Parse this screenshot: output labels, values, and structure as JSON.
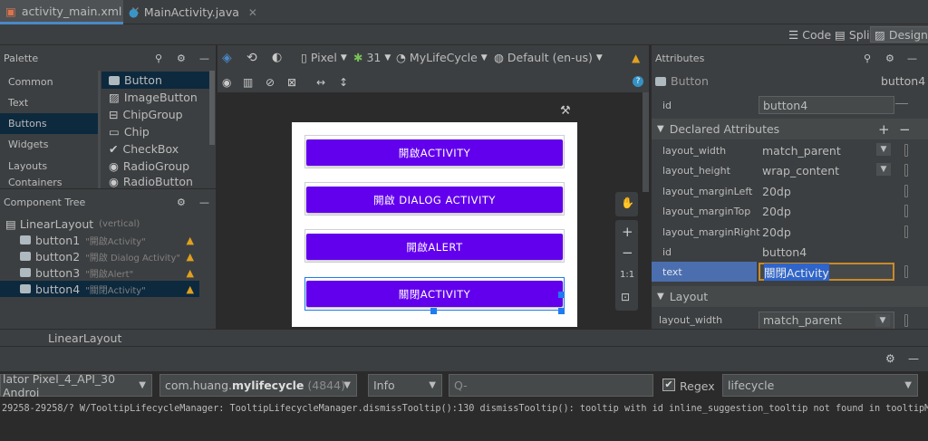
{
  "tabs": [
    {
      "label": "activity_main.xml",
      "active": true
    },
    {
      "label": "MainActivity.java",
      "active": false
    }
  ],
  "modes": {
    "code": "Code",
    "split": "Split",
    "design": "Design"
  },
  "palette": {
    "title": "Palette",
    "categories": [
      "Common",
      "Text",
      "Buttons",
      "Widgets",
      "Layouts",
      "Containers"
    ],
    "selected_category": "Buttons",
    "items": [
      "Button",
      "ImageButton",
      "ChipGroup",
      "Chip",
      "CheckBox",
      "RadioGroup",
      "RadioButton"
    ]
  },
  "component_tree": {
    "title": "Component Tree",
    "root_label": "LinearLayout",
    "root_hint": "(vertical)",
    "rows": [
      {
        "id": "button1",
        "hint": "\"開啟Activity\""
      },
      {
        "id": "button2",
        "hint": "\"開啟 Dialog Activity\""
      },
      {
        "id": "button3",
        "hint": "\"開啟Alert\""
      },
      {
        "id": "button4",
        "hint": "\"關閉Activity\""
      }
    ]
  },
  "toolbar": {
    "device": "Pixel",
    "api": "31",
    "theme": "MyLifeCycle",
    "locale": "Default (en-us)"
  },
  "canvas_buttons": [
    "開啟ACTIVITY",
    "開啟 DIALOG ACTIVITY",
    "開啟ALERT",
    "關閉ACTIVITY"
  ],
  "zoom": {
    "fit": "1:1"
  },
  "breadcrumb": "LinearLayout",
  "attributes": {
    "title": "Attributes",
    "widget_type": "Button",
    "widget_id": "button4",
    "id_label": "id",
    "id_value": "button4",
    "declared_title": "Declared Attributes",
    "declared": [
      {
        "name": "layout_width",
        "value": "match_parent"
      },
      {
        "name": "layout_height",
        "value": "wrap_content"
      },
      {
        "name": "layout_marginLeft",
        "value": "20dp"
      },
      {
        "name": "layout_marginTop",
        "value": "20dp"
      },
      {
        "name": "layout_marginRight",
        "value": "20dp"
      },
      {
        "name": "id",
        "value": "button4"
      },
      {
        "name": "text",
        "value": "關閉Activity"
      }
    ],
    "layout_title": "Layout",
    "layout_rows": [
      {
        "name": "layout_width",
        "value": "match_parent"
      }
    ]
  },
  "logcat": {
    "device": "lator Pixel_4_API_30 Androi",
    "process_pkg_prefix": "com.huang.",
    "process_pkg_bold": "mylifecycle",
    "process_pid": "(4844)",
    "level": "Info",
    "search_placeholder": "Q-",
    "regex_label": "Regex",
    "filter": "lifecycle",
    "line": "29258-29258/? W/TooltipLifecycleManager: TooltipLifecycleManager.dismissTooltip():130 dismissTooltip(): tooltip with id inline_suggestion_tooltip not found in tooltipManager."
  },
  "colors": {
    "accent": "#6200ee",
    "selection": "#0d293e",
    "warn": "#e0a020",
    "handle": "#1f7bf0"
  }
}
